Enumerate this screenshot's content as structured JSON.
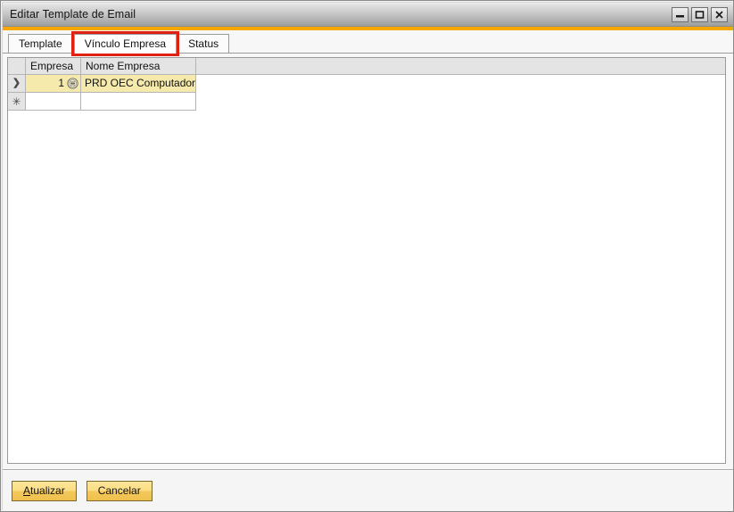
{
  "window": {
    "title": "Editar Template de Email",
    "controls": [
      {
        "name": "minimize-button",
        "glyph": "minimize"
      },
      {
        "name": "maximize-button",
        "glyph": "maximize"
      },
      {
        "name": "close-button",
        "glyph": "close"
      }
    ]
  },
  "tabs": [
    {
      "label": "Template",
      "active": false,
      "highlighted": false
    },
    {
      "label": "Vínculo Empresa",
      "active": true,
      "highlighted": true
    },
    {
      "label": "Status",
      "active": false,
      "highlighted": false
    }
  ],
  "grid": {
    "columns": [
      {
        "key": "rowhdr",
        "label": ""
      },
      {
        "key": "empresa",
        "label": "Empresa"
      },
      {
        "key": "nome",
        "label": "Nome Empresa"
      }
    ],
    "rows": [
      {
        "marker": "❯",
        "selected": true,
        "empresa": "1",
        "empresa_icon": "lookup-menu-icon",
        "nome": "PRD OEC Computadores"
      },
      {
        "marker": "✳",
        "selected": false,
        "empresa": "",
        "empresa_icon": "",
        "nome": ""
      }
    ]
  },
  "footer": {
    "update_button": {
      "accel": "A",
      "rest": "tualizar"
    },
    "cancel_button": {
      "label": "Cancelar"
    }
  },
  "colors": {
    "accent_strip": "#f5a800",
    "highlight_outline": "#e02010",
    "selected_row": "#f5eaac",
    "button_face": "#f3c85c",
    "header_face": "#e4e4e4"
  }
}
